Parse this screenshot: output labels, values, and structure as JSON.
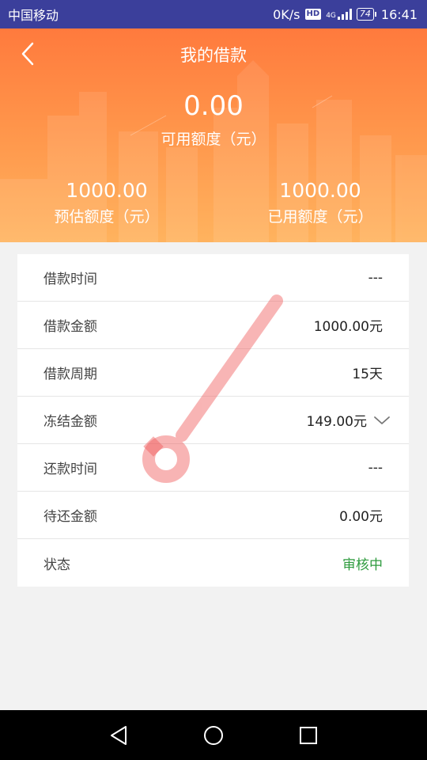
{
  "status_bar": {
    "carrier": "中国移动",
    "speed": "0K/s",
    "hd": "HD",
    "network": "4G",
    "battery": "74",
    "time": "16:41"
  },
  "header": {
    "title": "我的借款",
    "available_amount": "0.00",
    "available_label": "可用额度（元）",
    "estimated_amount": "1000.00",
    "estimated_label": "预估额度（元）",
    "used_amount": "1000.00",
    "used_label": "已用额度（元）"
  },
  "details": [
    {
      "label": "借款时间",
      "value": "---"
    },
    {
      "label": "借款金额",
      "value": "1000.00元"
    },
    {
      "label": "借款周期",
      "value": "15天"
    },
    {
      "label": "冻结金额",
      "value": "149.00元"
    },
    {
      "label": "还款时间",
      "value": "---"
    },
    {
      "label": "待还金额",
      "value": "0.00元"
    },
    {
      "label": "状态",
      "value": "审核中"
    }
  ],
  "colors": {
    "header_start": "#ff7a3d",
    "header_end": "#ffb35e",
    "status_green": "#2e9b3e",
    "status_bar": "#3b3f9b"
  },
  "icons": {
    "back": "chevron-left-icon",
    "expand": "chevron-down-icon",
    "nav_back": "triangle-back-icon",
    "nav_home": "circle-home-icon",
    "nav_recent": "square-recent-icon"
  }
}
